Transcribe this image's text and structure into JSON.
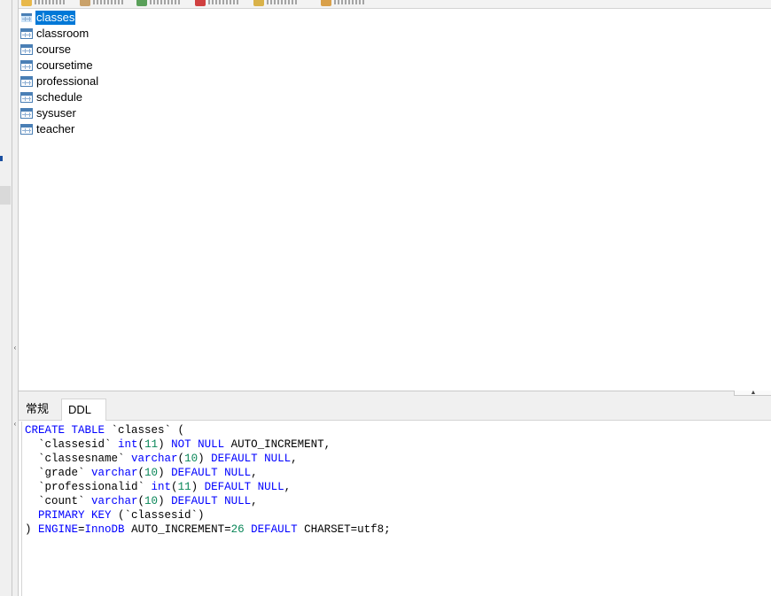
{
  "toolbar": {
    "items": [
      {
        "icon": "open-table-icon"
      },
      {
        "icon": "design-table-icon"
      },
      {
        "icon": "new-table-icon"
      },
      {
        "icon": "delete-table-icon"
      },
      {
        "icon": "import-wizard-icon"
      },
      {
        "icon": "export-wizard-icon"
      }
    ]
  },
  "tables": [
    {
      "name": "classes",
      "selected": true
    },
    {
      "name": "classroom"
    },
    {
      "name": "course"
    },
    {
      "name": "coursetime"
    },
    {
      "name": "professional"
    },
    {
      "name": "schedule"
    },
    {
      "name": "sysuser"
    },
    {
      "name": "teacher"
    }
  ],
  "tabs": {
    "general": "常规",
    "ddl": "DDL",
    "active": "DDL"
  },
  "ddl": {
    "lines": [
      [
        {
          "t": "CREATE TABLE",
          "c": "kw"
        },
        {
          "t": " `classes` ("
        }
      ],
      [
        {
          "t": "  `classesid` "
        },
        {
          "t": "int",
          "c": "kw"
        },
        {
          "t": "("
        },
        {
          "t": "11",
          "c": "num"
        },
        {
          "t": ") "
        },
        {
          "t": "NOT NULL",
          "c": "kw"
        },
        {
          "t": " AUTO_INCREMENT,"
        }
      ],
      [
        {
          "t": "  `classesname` "
        },
        {
          "t": "varchar",
          "c": "kw"
        },
        {
          "t": "("
        },
        {
          "t": "10",
          "c": "num"
        },
        {
          "t": ") "
        },
        {
          "t": "DEFAULT NULL",
          "c": "kw"
        },
        {
          "t": ","
        }
      ],
      [
        {
          "t": "  `grade` "
        },
        {
          "t": "varchar",
          "c": "kw"
        },
        {
          "t": "("
        },
        {
          "t": "10",
          "c": "num"
        },
        {
          "t": ") "
        },
        {
          "t": "DEFAULT NULL",
          "c": "kw"
        },
        {
          "t": ","
        }
      ],
      [
        {
          "t": "  `professionalid` "
        },
        {
          "t": "int",
          "c": "kw"
        },
        {
          "t": "("
        },
        {
          "t": "11",
          "c": "num"
        },
        {
          "t": ") "
        },
        {
          "t": "DEFAULT NULL",
          "c": "kw"
        },
        {
          "t": ","
        }
      ],
      [
        {
          "t": "  `count` "
        },
        {
          "t": "varchar",
          "c": "kw"
        },
        {
          "t": "("
        },
        {
          "t": "10",
          "c": "num"
        },
        {
          "t": ") "
        },
        {
          "t": "DEFAULT NULL",
          "c": "kw"
        },
        {
          "t": ","
        }
      ],
      [
        {
          "t": "  "
        },
        {
          "t": "PRIMARY KEY",
          "c": "kw"
        },
        {
          "t": " (`classesid`)"
        }
      ],
      [
        {
          "t": ") "
        },
        {
          "t": "ENGINE",
          "c": "kw"
        },
        {
          "t": "="
        },
        {
          "t": "InnoDB",
          "c": "kw"
        },
        {
          "t": " AUTO_INCREMENT="
        },
        {
          "t": "26",
          "c": "num"
        },
        {
          "t": " "
        },
        {
          "t": "DEFAULT",
          "c": "kw"
        },
        {
          "t": " CHARSET=utf8;"
        }
      ]
    ]
  },
  "colors": {
    "selection": "#0078d7",
    "keyword": "#0000ff",
    "number": "#098658"
  }
}
